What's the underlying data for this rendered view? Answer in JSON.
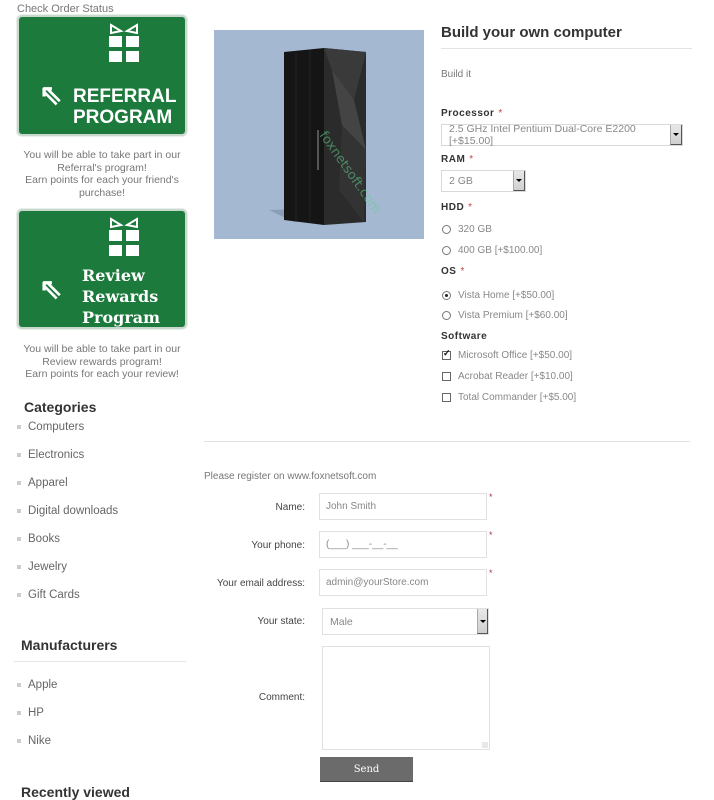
{
  "sidebar": {
    "check_order_link": "Check Order Status",
    "referral": {
      "banner_line1": "REFERRAL",
      "banner_line2": "PROGRAM",
      "caption_line1": "You will be able to take part in our",
      "caption_line2": "Referral's program!",
      "caption_line3": "Earn points for each your friend's",
      "caption_line4": "purchase!"
    },
    "review": {
      "banner_line1": "Review",
      "banner_line2": "Rewards",
      "banner_line3": "Program",
      "caption_line1": "You will be able to take part in our",
      "caption_line2": "Review rewards program!",
      "caption_line3": "Earn points for each your review!"
    },
    "categories": {
      "title": "Categories",
      "items": [
        "Computers",
        "Electronics",
        "Apparel",
        "Digital downloads",
        "Books",
        "Jewelry",
        "Gift Cards"
      ]
    },
    "manufacturers": {
      "title": "Manufacturers",
      "items": [
        "Apple",
        "HP",
        "Nike"
      ]
    },
    "recently_viewed": {
      "title": "Recently viewed"
    }
  },
  "product": {
    "image_alt": "server tower",
    "watermark": "foxnetsoft.com",
    "title": "Build your own computer",
    "short_description": "Build it",
    "attributes": {
      "processor": {
        "label": "Processor",
        "required": "*",
        "selected": "2.5 GHz Intel Pentium Dual-Core E2200 [+$15.00]"
      },
      "ram": {
        "label": "RAM",
        "required": "*",
        "selected": "2 GB"
      },
      "hdd": {
        "label": "HDD",
        "required": "*",
        "options": [
          {
            "label": "320 GB",
            "checked": false
          },
          {
            "label": "400 GB [+$100.00]",
            "checked": false
          }
        ]
      },
      "os": {
        "label": "OS",
        "required": "*",
        "options": [
          {
            "label": "Vista Home [+$50.00]",
            "checked": true
          },
          {
            "label": "Vista Premium [+$60.00]",
            "checked": false
          }
        ]
      },
      "software": {
        "label": "Software",
        "options": [
          {
            "label": "Microsoft Office [+$50.00]",
            "checked": true
          },
          {
            "label": "Acrobat Reader [+$10.00]",
            "checked": false
          },
          {
            "label": "Total Commander [+$5.00]",
            "checked": false
          }
        ]
      }
    }
  },
  "form": {
    "intro": "Please register on www.foxnetsoft.com",
    "required_mark": "*",
    "name": {
      "label": "Name:",
      "value": "John Smith"
    },
    "phone": {
      "label": "Your phone:",
      "value": "(___) ___-__-__"
    },
    "email": {
      "label": "Your email address:",
      "value": "admin@yourStore.com"
    },
    "state": {
      "label": "Your state:",
      "selected": "Male"
    },
    "comment": {
      "label": "Comment:",
      "value": ""
    },
    "send_label": "Send"
  },
  "colors": {
    "promo_green": "#1c7a3c",
    "image_bg": "#a5b8d1",
    "send_button": "#6b6b6b",
    "required": "#c64343"
  }
}
